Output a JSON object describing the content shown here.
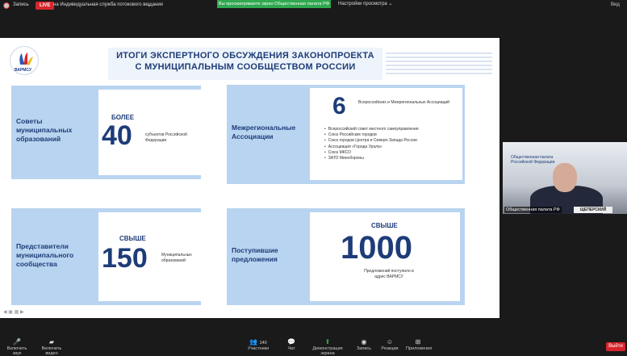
{
  "topbar": {
    "record_label": "Запись",
    "live_label": "LIVE",
    "stream_label": "на Индивидуальная служба потокового вещания",
    "share_banner": "Вы просматриваете экран Общественная палата РФ",
    "view_options": "Настройки просмотра ⌄",
    "view_label": "Вид"
  },
  "slide": {
    "logo_text": "ВАРМСУ",
    "title_line1": "ИТОГИ ЭКСПЕРТНОГО ОБСУЖДЕНИЯ ЗАКОНОПРОЕКТА",
    "title_line2": "С МУНИЦИПАЛЬНЫМ СООБЩЕСТВОМ РОССИИ",
    "cards": [
      {
        "label": "Советы муниципальных образований",
        "kicker": "БОЛЕЕ",
        "number": "40",
        "note": "субъектов Российской Федерации"
      },
      {
        "label": "Межрегиональные Ассоциации",
        "number": "6",
        "note": "Всероссийских и Межрегиональных Ассоциаций",
        "list": [
          "Всероссийский совет местного самоуправления",
          "Союз Российских городов",
          "Союз городов Центра и Северо-Запада России",
          "Ассоциация «Города Урала»",
          "Союз МКСО",
          "ЗАТО Минобороны"
        ]
      },
      {
        "label": "Представители муниципального сообщества",
        "kicker": "СВЫШЕ",
        "number": "150",
        "note": "Муниципальных образований"
      },
      {
        "label": "Поступившие предложения",
        "kicker": "СВЫШЕ",
        "number": "1000",
        "note": "Предложений поступило в адрес ВАРМСУ"
      }
    ]
  },
  "video": {
    "name": "Общественная палата РФ",
    "nameplate": "ЩЕПЕРСКИЙ",
    "wall_text": "Общественная палата Российской Федерации"
  },
  "toolbar": {
    "mute": "Включить звук",
    "video": "Включить видео",
    "participants_count": "140",
    "participants": "Участники",
    "chat": "Чат",
    "share": "Демонстрация экрана",
    "record": "Запись",
    "reactions": "Реакции",
    "apps": "Приложения",
    "end": "Выйти"
  },
  "colors": {
    "accent": "#1d3c78",
    "card": "#b9d4f0",
    "live": "#d6262c",
    "banner": "#2fa84f"
  }
}
